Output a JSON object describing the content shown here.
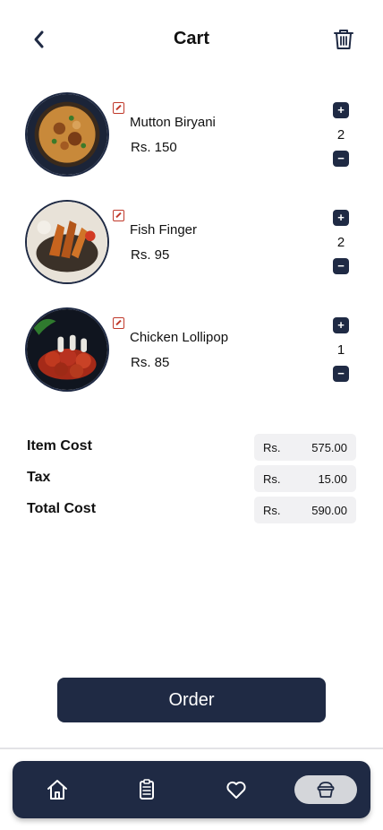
{
  "header": {
    "title": "Cart",
    "back_icon": "chevron-left-icon",
    "trash_icon": "trash-icon"
  },
  "cart": {
    "items": [
      {
        "name": "Mutton Biryani",
        "price": "Rs. 150",
        "quantity": "2",
        "image": "mutton-biryani-image"
      },
      {
        "name": "Fish Finger",
        "price": "Rs. 95",
        "quantity": "2",
        "image": "fish-finger-image"
      },
      {
        "name": "Chicken Lollipop",
        "price": "Rs. 85",
        "quantity": "1",
        "image": "chicken-lollipop-image"
      }
    ],
    "plus_label": "+",
    "minus_label": "−"
  },
  "summary": {
    "rows": [
      {
        "label": "Item Cost",
        "currency": "Rs.",
        "value": "575.00"
      },
      {
        "label": "Tax",
        "currency": "Rs.",
        "value": "15.00"
      },
      {
        "label": "Total Cost",
        "currency": "Rs.",
        "value": "590.00"
      }
    ]
  },
  "order_button": {
    "label": "Order"
  },
  "bottom_nav": {
    "items": [
      "home-icon",
      "clipboard-icon",
      "heart-icon",
      "basket-icon"
    ],
    "active": "basket-icon"
  },
  "colors": {
    "primary": "#1f2a44",
    "veg_mark": "#c0392b",
    "summary_box": "#f1f1f3",
    "nav_active": "#d4d6da"
  }
}
